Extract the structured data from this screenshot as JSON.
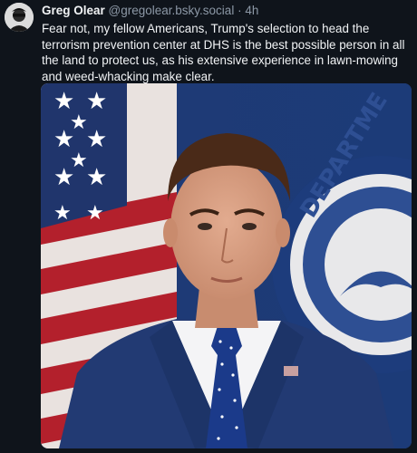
{
  "post": {
    "author": {
      "display_name": "Greg Olear",
      "handle": "@gregolear.bsky.social",
      "separator": "·",
      "timestamp": "4h",
      "avatar_icon": "avatar-icon"
    },
    "text": "Fear not, my fellow Americans, Trump's selection to head the terrorism prevention center at DHS is the best possible person in all the land to protect us, as his extensive experience in lawn-mowing and weed-whacking make clear.",
    "image": {
      "seal_text": "DEPARTME"
    }
  },
  "colors": {
    "background": "#0f141b",
    "text": "#f1f3f5",
    "muted": "#8c98a6"
  }
}
